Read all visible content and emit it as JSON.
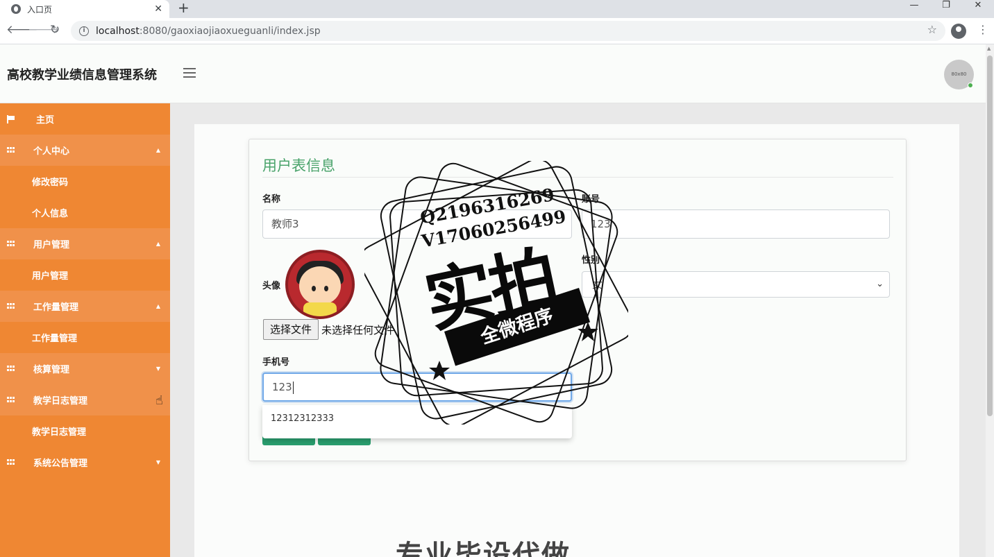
{
  "browser": {
    "tab_title": "入口页",
    "url_host": "localhost",
    "url_rest": ":8080/gaoxiaojiaoxueguanli/index.jsp",
    "win_min": "—",
    "win_restore": "❐",
    "win_close": "✕"
  },
  "header": {
    "title": "高校教学业绩信息管理系统",
    "avatar_text": "80x80"
  },
  "sidebar": {
    "items": [
      {
        "label": "主页",
        "type": "home"
      },
      {
        "label": "个人中心",
        "type": "parent",
        "caret": "▲"
      },
      {
        "label": "修改密码",
        "type": "child"
      },
      {
        "label": "个人信息",
        "type": "child"
      },
      {
        "label": "用户管理",
        "type": "parent",
        "caret": "▲"
      },
      {
        "label": "用户管理",
        "type": "child"
      },
      {
        "label": "工作量管理",
        "type": "parent",
        "caret": "▲"
      },
      {
        "label": "工作量管理",
        "type": "child"
      },
      {
        "label": "核算管理",
        "type": "parent",
        "caret": "▼"
      },
      {
        "label": "教学日志管理",
        "type": "parent",
        "caret": ""
      },
      {
        "label": "教学日志管理",
        "type": "child"
      },
      {
        "label": "系统公告管理",
        "type": "parent",
        "caret": "▼"
      }
    ]
  },
  "form": {
    "title": "用户表信息",
    "name_label": "名称",
    "name_value": "教师3",
    "account_label": "账号",
    "account_value": "123",
    "avatar_label": "头像",
    "file_button": "选择文件",
    "file_status": "未选择任何文件",
    "gender_label": "性别",
    "gender_value": "女",
    "phone_label": "手机号",
    "phone_value": "123",
    "autocomplete_option": "12312312333"
  },
  "stamp": {
    "line1": "Q2196316269",
    "line2": "V17060256499",
    "main": "实拍",
    "ribbon": "全微程序"
  },
  "watermark_bottom": "专业毕设代做",
  "colors": {
    "sidebar": "#ef8733",
    "sidebar_parent": "#f0914a",
    "accent_green": "#4aa36b",
    "button_green": "#2a9e6f"
  }
}
